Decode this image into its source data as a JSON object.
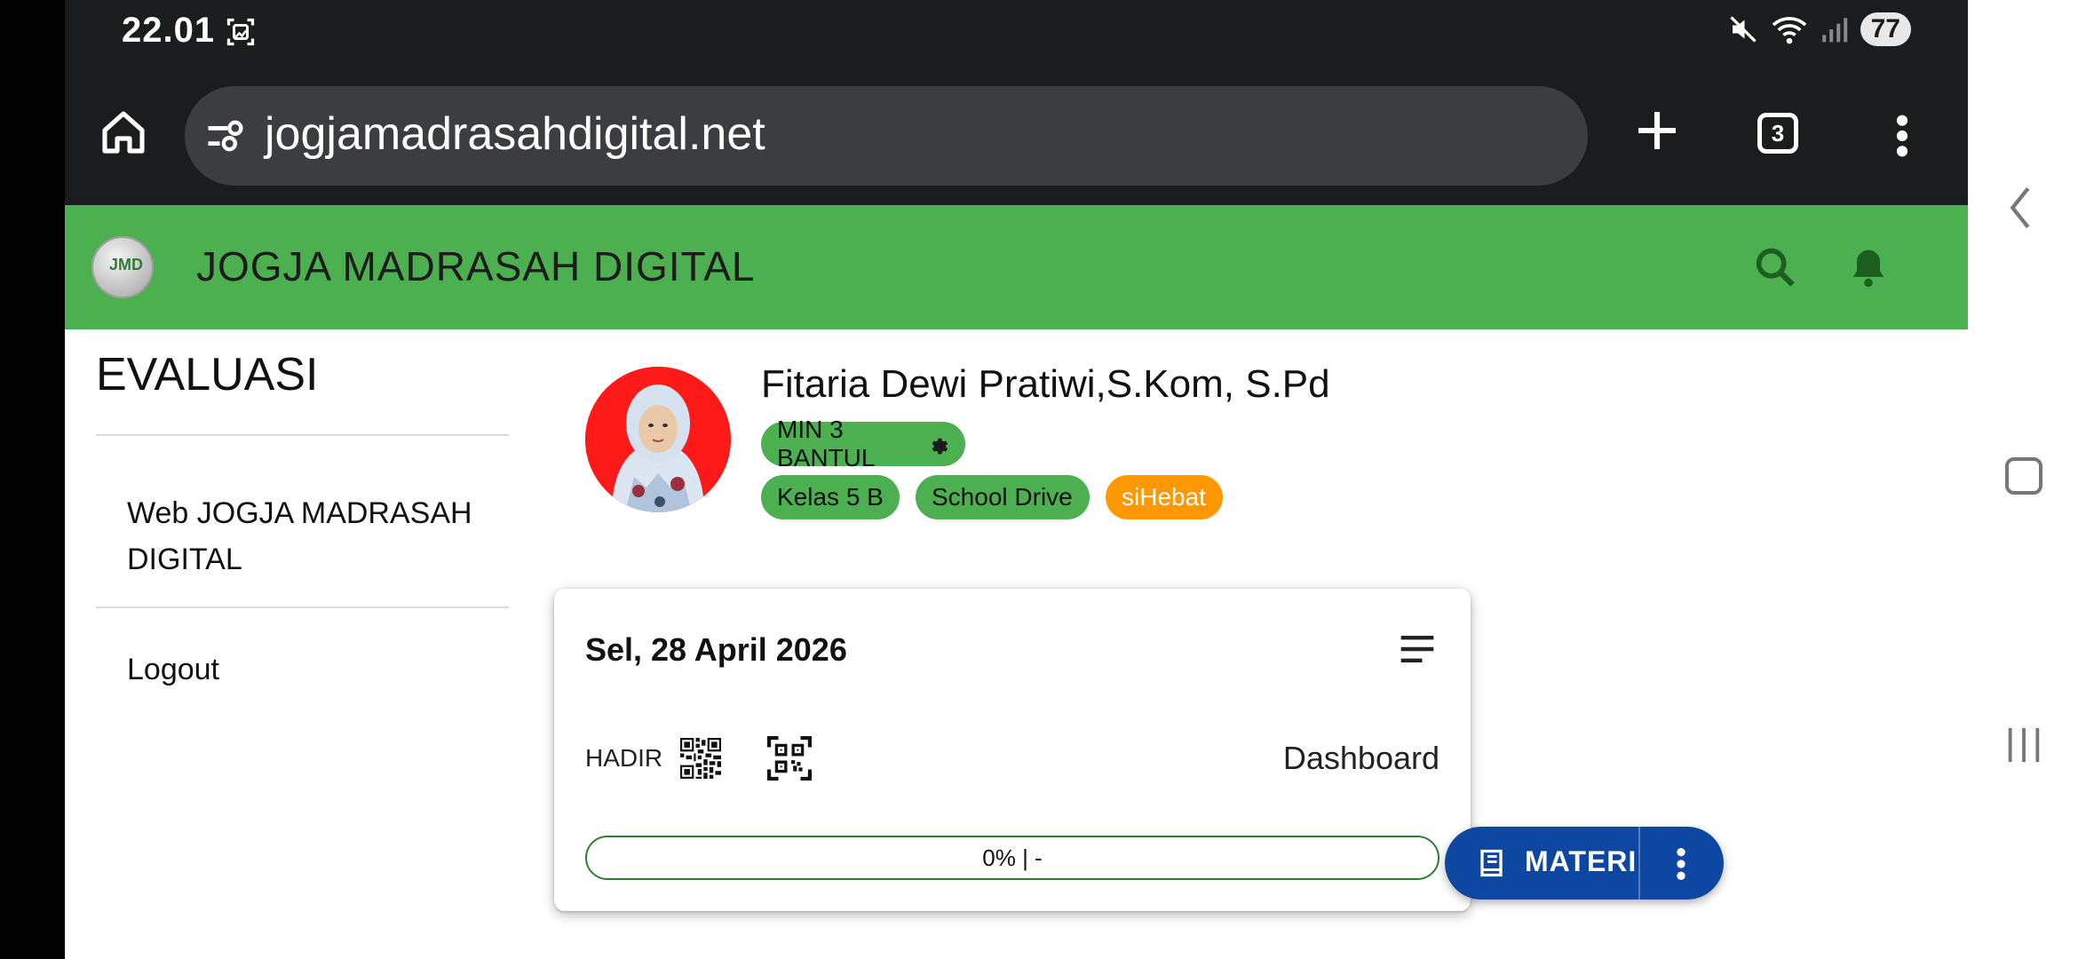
{
  "status_bar": {
    "time": "22.01",
    "battery": "77"
  },
  "browser": {
    "url": "jogjamadrasahdigital.net",
    "tab_count": "3"
  },
  "app": {
    "title": "JOGJA MADRASAH DIGITAL",
    "logo_text": "JMD"
  },
  "sidebar": {
    "heading": "EVALUASI",
    "items": [
      {
        "label_line1": "Web JOGJA MADRASAH",
        "label_line2": "DIGITAL"
      },
      {
        "label": "Logout"
      }
    ]
  },
  "profile": {
    "name": "Fitaria Dewi Pratiwi,S.Kom, S.Pd",
    "school": "MIN 3 BANTUL",
    "chips": [
      "Kelas 5 B",
      "School Drive",
      "siHebat"
    ]
  },
  "card": {
    "date": "Sel, 28 April 2026",
    "attendance_label": "HADIR",
    "dashboard_link": "Dashboard",
    "progress_value": 0,
    "progress_text": "0% | -"
  },
  "fab": {
    "label": "MATERI"
  },
  "colors": {
    "primary": "#4caf50",
    "accent_orange": "#ff9800",
    "fab_blue": "#0d47a1",
    "browser_dark": "#1b1c1e"
  }
}
